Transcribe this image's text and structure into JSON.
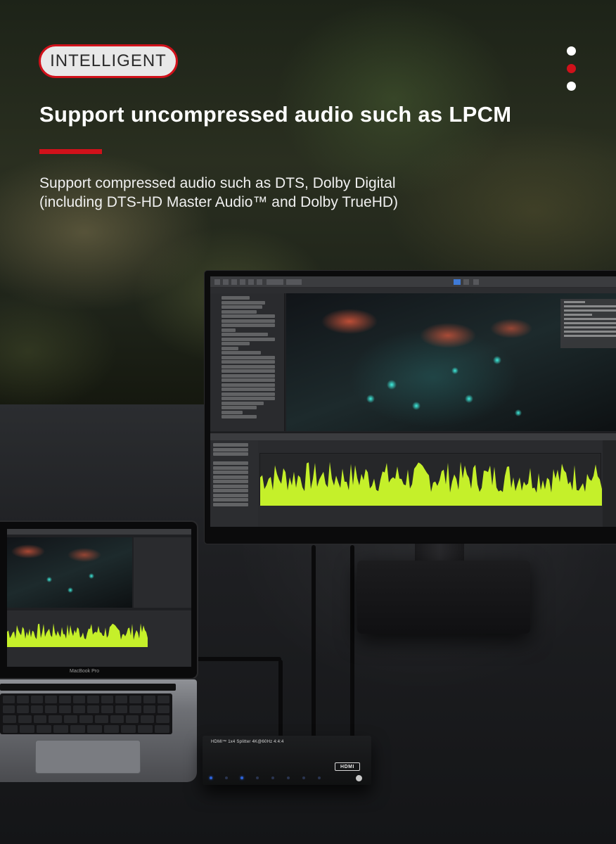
{
  "banner": {
    "tag_label": "INTELLIGENT",
    "headline": "Support uncompressed audio such as LPCM",
    "description_line1": "Support compressed audio such as DTS, Dolby Digital",
    "description_line2": "(including DTS-HD Master Audio™ and Dolby TrueHD)"
  },
  "pagination": {
    "total": 3,
    "active_index": 1
  },
  "laptop": {
    "brand": "MacBook Pro"
  },
  "splitter": {
    "label": "HDMI™ 1x4 Splitter 4K@60Hz 4:4:4",
    "logo": "HDMI"
  },
  "colors": {
    "accent": "#d0111a",
    "graph": "#c5f02a",
    "glow": "#3ff0e0"
  }
}
